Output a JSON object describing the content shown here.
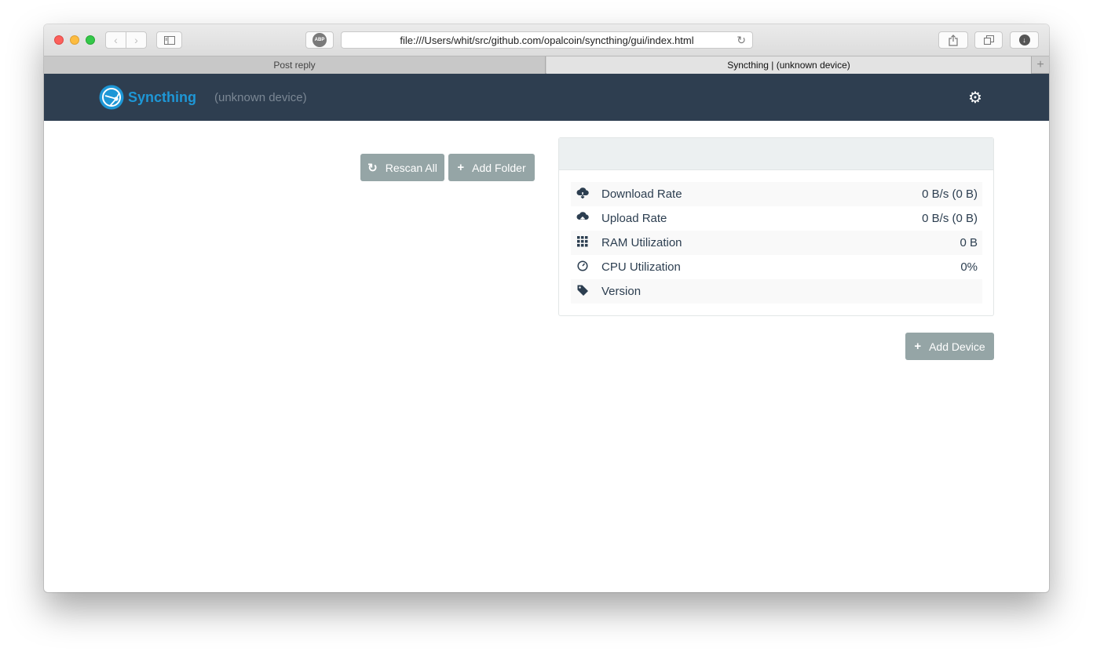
{
  "browser": {
    "url": "file:///Users/whit/src/github.com/opalcoin/syncthing/gui/index.html",
    "abp_badge": "ABP",
    "tabs": [
      {
        "label": "Post reply"
      },
      {
        "label": "Syncthing | (unknown device)"
      }
    ],
    "new_tab_label": "+"
  },
  "navbar": {
    "brand": "Syncthing",
    "device": "(unknown device)"
  },
  "folders": {
    "rescan_label": "Rescan All",
    "add_folder_label": "Add Folder"
  },
  "stats": {
    "rows": [
      {
        "icon": "cloud-download-icon",
        "label": "Download Rate",
        "value": "0 B/s (0 B)"
      },
      {
        "icon": "cloud-upload-icon",
        "label": "Upload Rate",
        "value": "0 B/s (0 B)"
      },
      {
        "icon": "grid-icon",
        "label": "RAM Utilization",
        "value": "0 B"
      },
      {
        "icon": "dashboard-icon",
        "label": "CPU Utilization",
        "value": "0%"
      },
      {
        "icon": "tag-icon",
        "label": "Version",
        "value": ""
      }
    ]
  },
  "devices": {
    "add_device_label": "Add Device"
  },
  "colors": {
    "navbar_bg": "#2e3e50",
    "brand": "#1e97d6",
    "button_bg": "#95a5a6",
    "text": "#2c3e50"
  }
}
